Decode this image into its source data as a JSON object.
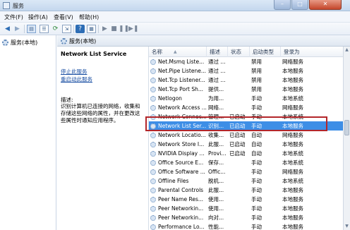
{
  "window": {
    "title": "服务"
  },
  "menu": [
    "文件(F)",
    "操作(A)",
    "查看(V)",
    "帮助(H)"
  ],
  "toolbar_icons": [
    "back-arrow-icon",
    "forward-arrow-icon",
    "console-tree-icon",
    "list-icon",
    "refresh-icon",
    "export-icon",
    "help-icon",
    "properties-icon",
    "play-icon",
    "stop-icon",
    "pause-icon",
    "restart-icon"
  ],
  "tree": {
    "root_label": "服务(本地)"
  },
  "header": {
    "label": "服务(本地)"
  },
  "detail": {
    "service_name": "Network List Service",
    "stop_link": "停止此服务",
    "restart_link": "重启动此服务",
    "desc_label": "描述:",
    "desc_text": "识别计算机已连接的网络，收集和存储这些网络的属性，并在更改这些属性时通知应用程序。"
  },
  "columns": {
    "name": "名称",
    "desc": "描述",
    "status": "状态",
    "start": "启动类型",
    "logon": "登录为"
  },
  "services": [
    {
      "name": "Net.Msmq Liste...",
      "desc": "通过 ...",
      "status": "",
      "start": "禁用",
      "logon": "网络服务"
    },
    {
      "name": "Net.Pipe Listene...",
      "desc": "通过 ...",
      "status": "",
      "start": "禁用",
      "logon": "本地服务"
    },
    {
      "name": "Net.Tcp Listener...",
      "desc": "通过 ...",
      "status": "",
      "start": "禁用",
      "logon": "本地服务"
    },
    {
      "name": "Net.Tcp Port Sh...",
      "desc": "提供...",
      "status": "",
      "start": "禁用",
      "logon": "本地服务"
    },
    {
      "name": "Netlogon",
      "desc": "为用...",
      "status": "",
      "start": "手动",
      "logon": "本地系统"
    },
    {
      "name": "Network Access ...",
      "desc": "网络...",
      "status": "",
      "start": "手动",
      "logon": "网络服务"
    },
    {
      "name": "Network Connec...",
      "desc": "管理...",
      "status": "已启动",
      "start": "手动",
      "logon": "本地系统"
    },
    {
      "name": "Network List Ser...",
      "desc": "识别...",
      "status": "已启动",
      "start": "手动",
      "logon": "本地服务"
    },
    {
      "name": "Network Locatio...",
      "desc": "收集...",
      "status": "已启动",
      "start": "自动",
      "logon": "网络服务"
    },
    {
      "name": "Network Store I...",
      "desc": "此服...",
      "status": "已启动",
      "start": "自动",
      "logon": "本地服务"
    },
    {
      "name": "NVIDIA Display ...",
      "desc": "Provi...",
      "status": "已启动",
      "start": "自动",
      "logon": "本地系统"
    },
    {
      "name": "Office  Source E...",
      "desc": "保存...",
      "status": "",
      "start": "手动",
      "logon": "本地系统"
    },
    {
      "name": "Office Software ...",
      "desc": "Offic...",
      "status": "",
      "start": "手动",
      "logon": "网络服务"
    },
    {
      "name": "Offline Files",
      "desc": "脱机...",
      "status": "",
      "start": "手动",
      "logon": "本地系统"
    },
    {
      "name": "Parental Controls",
      "desc": "此服...",
      "status": "",
      "start": "手动",
      "logon": "本地服务"
    },
    {
      "name": "Peer Name Res...",
      "desc": "使用...",
      "status": "",
      "start": "手动",
      "logon": "本地服务"
    },
    {
      "name": "Peer Networkin...",
      "desc": "使用...",
      "status": "",
      "start": "手动",
      "logon": "本地服务"
    },
    {
      "name": "Peer Networkin...",
      "desc": "向对...",
      "status": "",
      "start": "手动",
      "logon": "本地服务"
    },
    {
      "name": "Performance Lo...",
      "desc": "性能...",
      "status": "",
      "start": "手动",
      "logon": "本地服务"
    }
  ],
  "selected_service_index": 7
}
